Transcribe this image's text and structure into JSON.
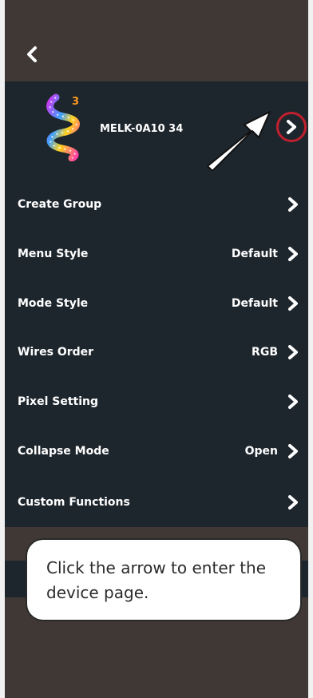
{
  "header": {
    "back_icon": "chevron-left-icon"
  },
  "device": {
    "name": "MELK-0A10   34",
    "logo_badge": "3",
    "arrow_icon": "chevron-right-icon",
    "highlight_color": "#c0202e"
  },
  "settings": [
    {
      "label": "Create Group",
      "value": ""
    },
    {
      "label": "Menu Style",
      "value": "Default"
    },
    {
      "label": "Mode Style",
      "value": "Default"
    },
    {
      "label": "Wires Order",
      "value": "RGB"
    },
    {
      "label": "Pixel Setting",
      "value": ""
    },
    {
      "label": "Collapse Mode",
      "value": "Open"
    },
    {
      "label": "Custom Functions",
      "value": ""
    }
  ],
  "tooltip": {
    "text": "Click the arrow to enter the device page."
  },
  "colors": {
    "background": "#403834",
    "panel": "#1e262d",
    "text": "#ffffff"
  }
}
